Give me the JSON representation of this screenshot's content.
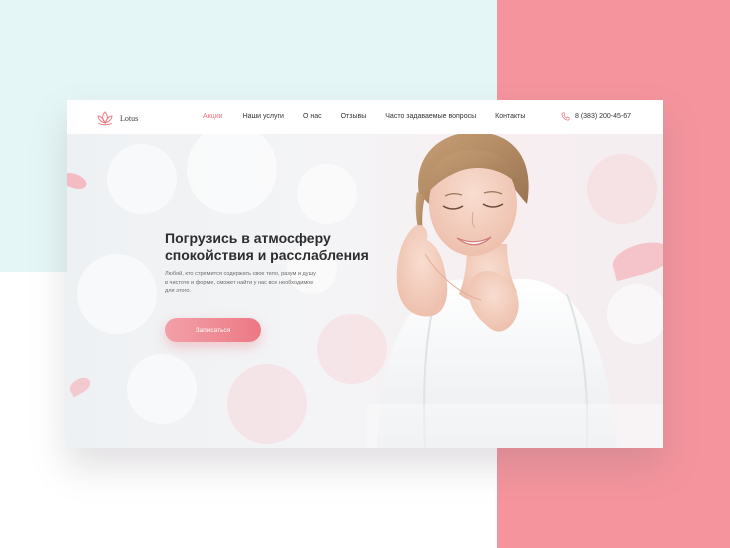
{
  "brand": {
    "name": "Lotus",
    "logo_icon": "lotus-icon"
  },
  "nav": {
    "items": [
      {
        "label": "Акции",
        "active": true
      },
      {
        "label": "Наши услуги",
        "active": false
      },
      {
        "label": "О нас",
        "active": false
      },
      {
        "label": "Отзывы",
        "active": false
      },
      {
        "label": "Часто задаваемые вопросы",
        "active": false
      },
      {
        "label": "Контакты",
        "active": false
      }
    ]
  },
  "contact": {
    "phone": "8 (383) 200-45-67",
    "icon": "phone-icon"
  },
  "hero": {
    "title_line1": "Погрузись в атмосферу",
    "title_line2": "спокойствия и расслабления",
    "desc_line1": "Любой, кто стремится содержать свое тело, разум и душу",
    "desc_line2": "в чистоте и форме, сможет найти у нас все необходимое",
    "desc_line3": "для этого.",
    "cta_label": "Записаться"
  },
  "colors": {
    "accent": "#ef7580",
    "mint_background": "#e5f6f7",
    "pink_background": "#f5949d",
    "text_dark": "#2d2d2d"
  }
}
